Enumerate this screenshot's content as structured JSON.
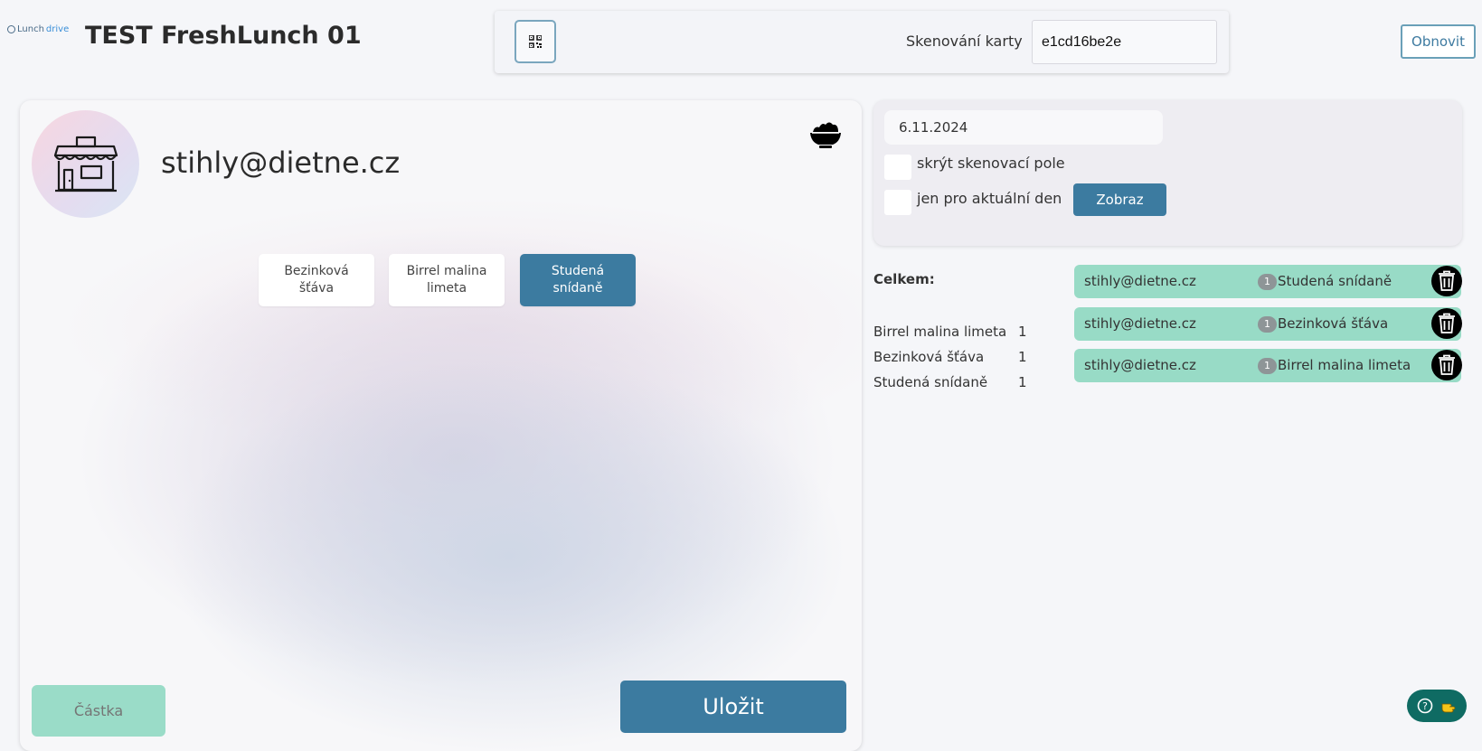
{
  "header": {
    "logo_part1": "Lunch",
    "logo_part2": "drive",
    "title": "TEST FreshLunch 01",
    "scan_label": "Skenování karty",
    "scan_value": "e1cd16be2e",
    "refresh_label": "Obnovit"
  },
  "customer": {
    "email": "stihly@dietne.cz"
  },
  "products": [
    {
      "label_line1": "Bezinková",
      "label_line2": "šťáva",
      "active": false
    },
    {
      "label_line1": "Birrel malina",
      "label_line2": "limeta",
      "active": false
    },
    {
      "label_line1": "Studená",
      "label_line2": "snídaně",
      "active": true
    }
  ],
  "actions": {
    "amount_placeholder": "Částka",
    "save_label": "Uložit"
  },
  "filter": {
    "date": "6.11.2024",
    "hide_scan_label": "skrýt skenovací pole",
    "current_day_label": "jen pro aktuální den",
    "show_label": "Zobraz"
  },
  "summary": {
    "title": "Celkem:",
    "rows": [
      {
        "name": "Birrel malina limeta",
        "count": "1"
      },
      {
        "name": "Bezinková šťáva",
        "count": "1"
      },
      {
        "name": "Studená snídaně",
        "count": "1"
      }
    ]
  },
  "orders": [
    {
      "email": "stihly@dietne.cz",
      "qty": "1",
      "product": "Studená snídaně"
    },
    {
      "email": "stihly@dietne.cz",
      "qty": "1",
      "product": "Bezinková šťáva"
    },
    {
      "email": "stihly@dietne.cz",
      "qty": "1",
      "product": "Birrel malina limeta"
    }
  ],
  "colors": {
    "primary": "#3c7ba0",
    "mint": "#98dbc6",
    "help": "#0f6b63"
  }
}
